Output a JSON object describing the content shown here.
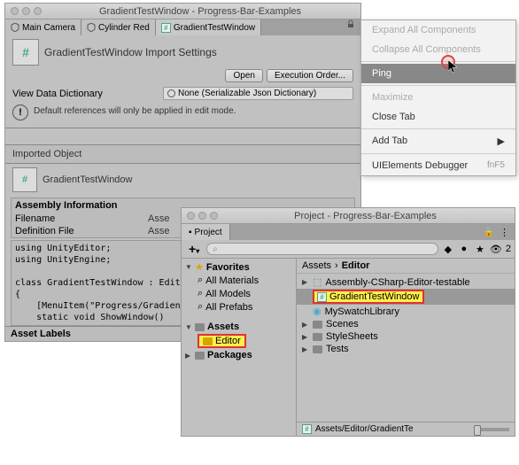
{
  "inspector": {
    "title": "GradientTestWindow - Progress-Bar-Examples",
    "tabs": [
      {
        "label": "Main Camera",
        "icon": "cube"
      },
      {
        "label": "Cylinder Red",
        "icon": "cube"
      },
      {
        "label": "GradientTestWindow",
        "icon": "script",
        "active": true
      }
    ],
    "header_title": "GradientTestWindow Import Settings",
    "open_btn": "Open",
    "exec_btn": "Execution Order...",
    "view_dict_label": "View Data Dictionary",
    "view_dict_value": "None (Serializable Json Dictionary)",
    "info_text": "Default references will only be applied in edit mode.",
    "imported_label": "Imported Object",
    "imported_name": "GradientTestWindow",
    "asm_header": "Assembly Information",
    "asm_rows": [
      {
        "l": "Filename",
        "r": "Asse"
      },
      {
        "l": "Definition File",
        "r": "Asse"
      }
    ],
    "code": "using UnityEditor;\nusing UnityEngine;\n\nclass GradientTestWindow : EditorW\n{\n    [MenuItem(\"Progress/GradientTe\n    static void ShowWindow()",
    "asset_labels": "Asset Labels"
  },
  "menu": {
    "items": [
      {
        "label": "Expand All Components",
        "disabled": true
      },
      {
        "label": "Collapse All Components",
        "disabled": true
      },
      {
        "sep": true
      },
      {
        "label": "Ping",
        "hover": true
      },
      {
        "sep": true
      },
      {
        "label": "Maximize",
        "disabled": true
      },
      {
        "label": "Close Tab"
      },
      {
        "sep": true
      },
      {
        "label": "Add Tab",
        "arrow": true
      },
      {
        "sep": true
      },
      {
        "label": "UIElements Debugger",
        "shortcut": "fnF5"
      }
    ]
  },
  "project": {
    "title": "Project - Progress-Bar-Examples",
    "tab": "Project",
    "search_placeholder": "",
    "count": "2",
    "tree": {
      "favorites": "Favorites",
      "fav_items": [
        "All Materials",
        "All Models",
        "All Prefabs"
      ],
      "assets": "Assets",
      "editor": "Editor",
      "packages": "Packages"
    },
    "breadcrumb": [
      "Assets",
      "Editor"
    ],
    "items": [
      {
        "label": "Assembly-CSharp-Editor-testable",
        "icon": "puzzle"
      },
      {
        "label": "GradientTestWindow",
        "icon": "cs",
        "selected": true,
        "highlight": true
      },
      {
        "label": "MySwatchLibrary",
        "icon": "swatch"
      },
      {
        "label": "Scenes",
        "icon": "folder"
      },
      {
        "label": "StyleSheets",
        "icon": "folder"
      },
      {
        "label": "Tests",
        "icon": "folder"
      }
    ],
    "path": "Assets/Editor/GradientTe"
  }
}
